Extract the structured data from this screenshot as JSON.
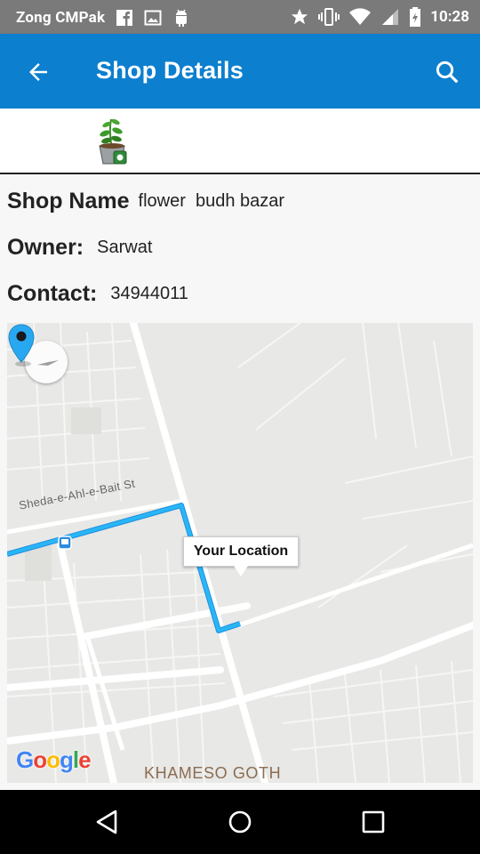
{
  "status_bar": {
    "carrier": "Zong CMPak",
    "time": "10:28",
    "left_icons": [
      "facebook-icon",
      "image-icon",
      "android-icon"
    ],
    "right_icons": [
      "star-icon",
      "vibrate-icon",
      "wifi-icon",
      "signal-icon",
      "battery-icon"
    ]
  },
  "app_bar": {
    "title": "Shop Details",
    "back_icon": "arrow-back-icon",
    "search_icon": "search-icon",
    "color": "#0c7fcf"
  },
  "shop": {
    "name_label": "Shop Name",
    "name_value": "flower  budh bazar",
    "owner_label": "Owner:",
    "owner_value": "Sarwat",
    "contact_label": "Contact:",
    "contact_value": "34944011"
  },
  "map": {
    "marker_label": "Your Location",
    "street_label": "Sheda-e-Ahl-e-Bait St",
    "area_label": "KHAMESO GOTH",
    "attribution": "Google",
    "route_color": "#29a8f2"
  },
  "nav_bar": {
    "back": "nav-back-icon",
    "home": "nav-home-icon",
    "recents": "nav-recents-icon"
  }
}
